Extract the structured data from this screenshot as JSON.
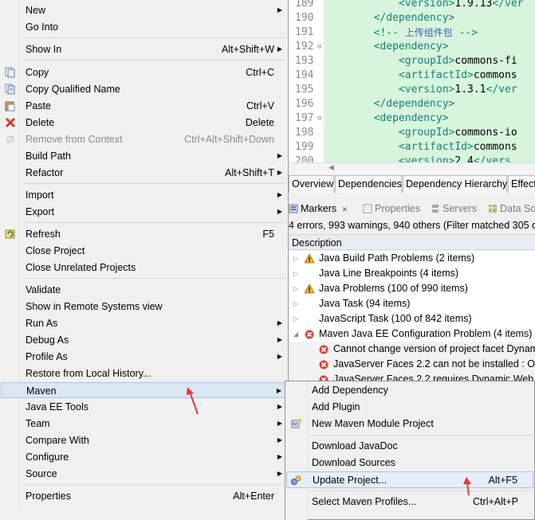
{
  "editor": {
    "lines": [
      {
        "num": "189",
        "fold": "",
        "parts": [
          {
            "t": "            <version>",
            "c": "tag"
          },
          {
            "t": "1.9.13",
            "c": "txt"
          },
          {
            "t": "</ver",
            "c": "tag"
          }
        ]
      },
      {
        "num": "190",
        "fold": "",
        "parts": [
          {
            "t": "        </dependency>",
            "c": "tag"
          }
        ]
      },
      {
        "num": "191",
        "fold": "",
        "parts": [
          {
            "t": "        <!-- ",
            "c": "tag"
          },
          {
            "t": "上传组件包",
            "c": "cmt"
          },
          {
            "t": " -->",
            "c": "tag"
          }
        ]
      },
      {
        "num": "192",
        "fold": "⊖",
        "parts": [
          {
            "t": "        <dependency>",
            "c": "tag"
          }
        ]
      },
      {
        "num": "193",
        "fold": "",
        "parts": [
          {
            "t": "            <groupId>",
            "c": "tag"
          },
          {
            "t": "commons-fi",
            "c": "txt"
          }
        ]
      },
      {
        "num": "194",
        "fold": "",
        "parts": [
          {
            "t": "            <artifactId>",
            "c": "tag"
          },
          {
            "t": "commons",
            "c": "txt"
          }
        ]
      },
      {
        "num": "195",
        "fold": "",
        "parts": [
          {
            "t": "            <version>",
            "c": "tag"
          },
          {
            "t": "1.3.1",
            "c": "txt"
          },
          {
            "t": "</ver",
            "c": "tag"
          }
        ]
      },
      {
        "num": "196",
        "fold": "",
        "parts": [
          {
            "t": "        </dependency>",
            "c": "tag"
          }
        ]
      },
      {
        "num": "197",
        "fold": "⊖",
        "parts": [
          {
            "t": "        <dependency>",
            "c": "tag"
          }
        ]
      },
      {
        "num": "198",
        "fold": "",
        "parts": [
          {
            "t": "            <groupId>",
            "c": "tag"
          },
          {
            "t": "commons-io",
            "c": "txt"
          }
        ]
      },
      {
        "num": "199",
        "fold": "",
        "parts": [
          {
            "t": "            <artifactId>",
            "c": "tag"
          },
          {
            "t": "commons",
            "c": "txt"
          }
        ]
      },
      {
        "num": "200",
        "fold": "",
        "parts": [
          {
            "t": "            <version>",
            "c": "tag"
          },
          {
            "t": "2.4",
            "c": "txt"
          },
          {
            "t": "</vers",
            "c": "tag"
          }
        ]
      }
    ]
  },
  "pom_tabs": [
    "Overview",
    "Dependencies",
    "Dependency Hierarchy",
    "Effecti"
  ],
  "views": {
    "markers": "Markers",
    "markers_close": "✕",
    "properties": "Properties",
    "servers": "Servers",
    "data_source": "Data So"
  },
  "markers": {
    "filter_summary": "4 errors, 993 warnings, 940 others (Filter matched 305 o",
    "column_description": "Description",
    "rows": [
      {
        "label": "Java Build Path Problems (2 items)",
        "icon": "warning",
        "twisty": "▷"
      },
      {
        "label": "Java Line Breakpoints (4 items)",
        "icon": "",
        "twisty": "▷"
      },
      {
        "label": "Java Problems (100 of 990 items)",
        "icon": "warning",
        "twisty": "▷"
      },
      {
        "label": "Java Task (94 items)",
        "icon": "",
        "twisty": "▷"
      },
      {
        "label": "JavaScript Task (100 of 842 items)",
        "icon": "",
        "twisty": "▷"
      },
      {
        "label": "Maven Java EE Configuration Problem (4 items)",
        "icon": "error",
        "twisty": "◢"
      },
      {
        "label": "Cannot change version of project facet Dynam",
        "icon": "error",
        "twisty": ""
      },
      {
        "label": "JavaServer Faces 2.2 can not be installed : On",
        "icon": "error",
        "twisty": ""
      },
      {
        "label": "JavaServer Faces 2.2 requires Dynamic Web M",
        "icon": "error",
        "twisty": ""
      }
    ]
  },
  "context_menu": {
    "new": "New",
    "go_into": "Go Into",
    "show_in": "Show In",
    "show_in_sc": "Alt+Shift+W",
    "copy": "Copy",
    "copy_sc": "Ctrl+C",
    "copy_qualified": "Copy Qualified Name",
    "paste": "Paste",
    "paste_sc": "Ctrl+V",
    "delete": "Delete",
    "delete_sc": "Delete",
    "remove_context": "Remove from Context",
    "remove_context_sc": "Ctrl+Alt+Shift+Down",
    "build_path": "Build Path",
    "refactor": "Refactor",
    "refactor_sc": "Alt+Shift+T",
    "import": "Import",
    "export": "Export",
    "refresh": "Refresh",
    "refresh_sc": "F5",
    "close_project": "Close Project",
    "close_unrelated": "Close Unrelated Projects",
    "validate": "Validate",
    "show_remote": "Show in Remote Systems view",
    "run_as": "Run As",
    "debug_as": "Debug As",
    "profile_as": "Profile As",
    "restore_history": "Restore from Local History...",
    "maven": "Maven",
    "java_ee_tools": "Java EE Tools",
    "team": "Team",
    "compare_with": "Compare With",
    "configure": "Configure",
    "source": "Source",
    "properties": "Properties",
    "properties_sc": "Alt+Enter"
  },
  "maven_submenu": {
    "add_dependency": "Add Dependency",
    "add_plugin": "Add Plugin",
    "new_module": "New Maven Module Project",
    "download_javadoc": "Download JavaDoc",
    "download_sources": "Download Sources",
    "update_project": "Update Project...",
    "update_project_sc": "Alt+F5",
    "select_profiles": "Select Maven Profiles...",
    "select_profiles_sc": "Ctrl+Alt+P"
  },
  "colors": {
    "accent_arrow": "#e53935",
    "highlight": "#dbe6f4",
    "code_bg": "#d6f5dc",
    "tag": "#17807a"
  }
}
